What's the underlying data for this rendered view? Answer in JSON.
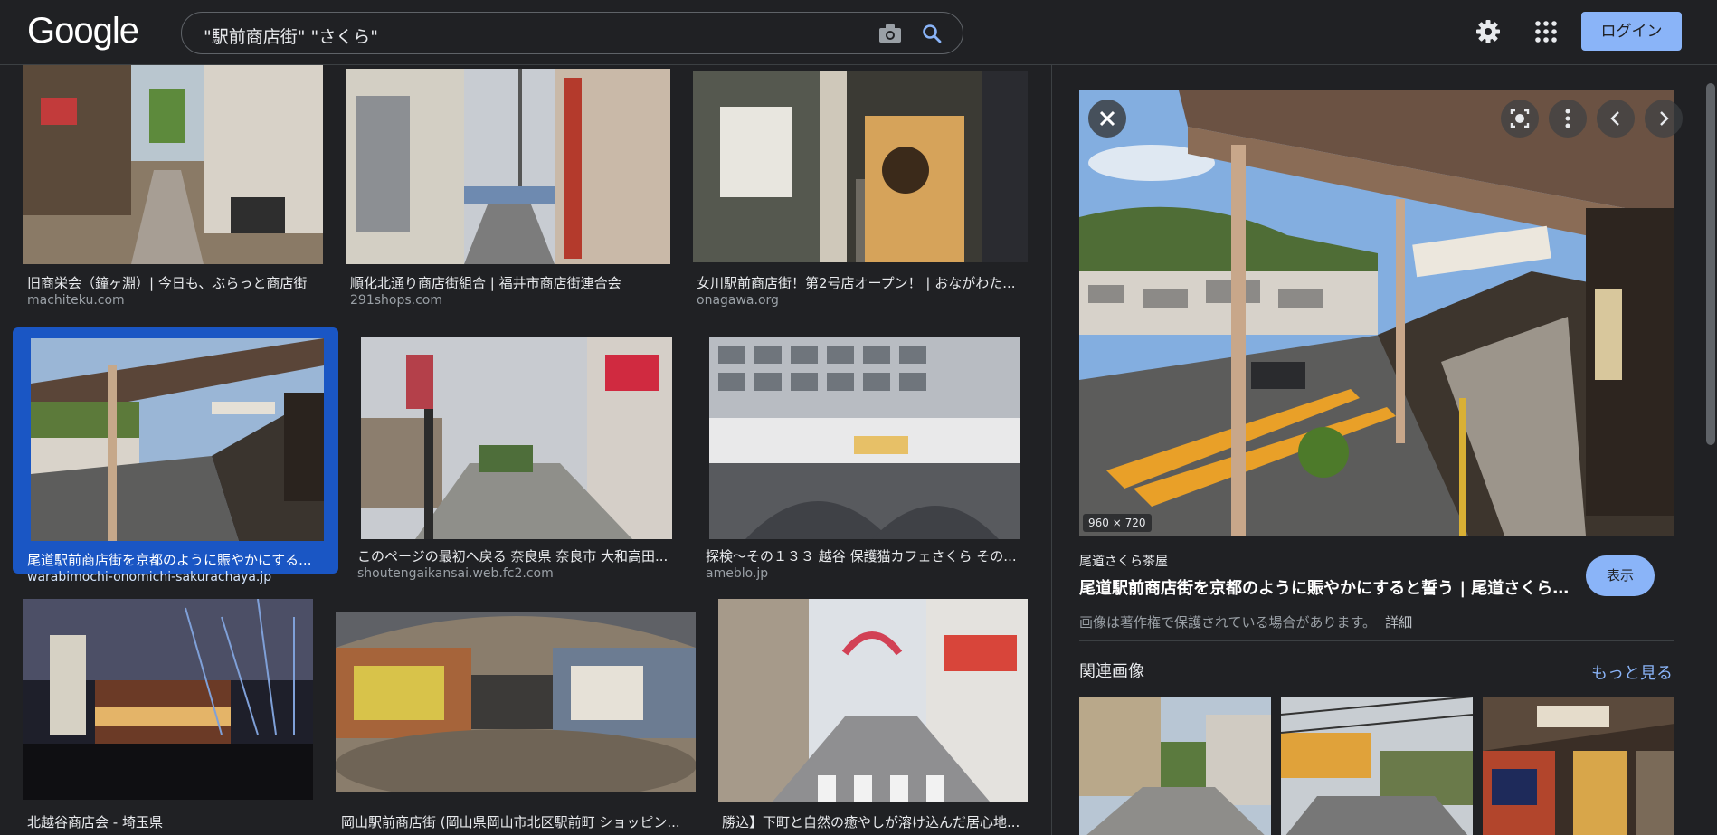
{
  "header": {
    "logo": "Google",
    "search_query": "\"駅前商店街\" \"さくら\"",
    "login_label": "ログイン"
  },
  "results": [
    {
      "title": "旧商栄会（鐘ヶ淵）| 今日も、ぶらっと商店街",
      "domain": "machiteku.com"
    },
    {
      "title": "順化北通り商店街組合 | 福井市商店街連合会",
      "domain": "291shops.com"
    },
    {
      "title": "女川駅前商店街！第2号店オープン！ | おながわた...",
      "domain": "onagawa.org"
    },
    {
      "title": "尾道駅前商店街を京都のように賑やかにする...",
      "domain": "warabimochi-onomichi-sakurachaya.jp"
    },
    {
      "title": "このページの最初へ戻る 奈良県 奈良市 大和高田...",
      "domain": "shoutengaikansai.web.fc2.com"
    },
    {
      "title": "探検〜その１３３ 越谷 保護猫カフェさくら その...",
      "domain": "ameblo.jp"
    },
    {
      "title": "北越谷商店会 - 埼玉県",
      "domain": ""
    },
    {
      "title": "岡山駅前商店街 (岡山県岡山市北区駅前町 ショッピン...",
      "domain": ""
    },
    {
      "title": "勝込】下町と自然の癒やしが溶け込んだ居心地...",
      "domain": ""
    }
  ],
  "panel": {
    "dimensions": "960 × 720",
    "source_name": "尾道さくら茶屋",
    "title": "尾道駅前商店街を京都のように賑やかにすると誓う | 尾道さくら茶屋",
    "view_label": "表示",
    "copyright_text": "画像は著作権で保護されている場合があります。",
    "copyright_detail": "詳細",
    "related_label": "関連画像",
    "more_label": "もっと見る"
  },
  "colors": {
    "background": "#202124",
    "accent": "#8ab4f8",
    "selected": "#1a56c4"
  }
}
